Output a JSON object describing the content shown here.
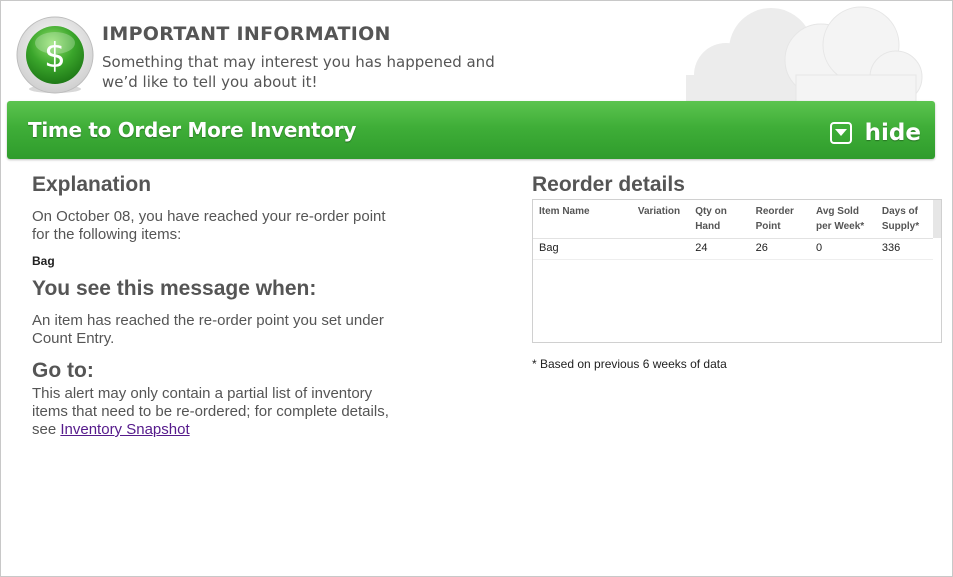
{
  "header": {
    "title": "IMPORTANT INFORMATION",
    "subtitle": "Something that may interest you has happened and we’d like to tell you about it!",
    "badge_icon": "dollar-icon",
    "badge_symbol": "$"
  },
  "banner": {
    "title": "Time to Order More Inventory",
    "hide_label": "hide",
    "hide_icon": "collapse-down-icon",
    "color": "#3fae38"
  },
  "explanation": {
    "heading": "Explanation",
    "text": "On October 08, you have reached your re-order point for the following items:",
    "items": [
      "Bag"
    ]
  },
  "when": {
    "heading": "You see this message when:",
    "text": "An item has reached the re-order point you set under Count Entry."
  },
  "goto": {
    "heading": "Go to:",
    "text": "This alert may only contain a partial list of inventory items that need to be re-ordered; for complete details, see ",
    "link_label": "Inventory Snapshot"
  },
  "reorder": {
    "heading": "Reorder details",
    "columns": [
      "Item Name",
      "Variation",
      "Qty on Hand",
      "Reorder Point",
      "Avg Sold per Week*",
      "Days of Supply*"
    ],
    "rows": [
      [
        "Bag",
        "",
        "24",
        "26",
        "0",
        "336"
      ]
    ],
    "footnote": "* Based on previous 6 weeks of data"
  }
}
